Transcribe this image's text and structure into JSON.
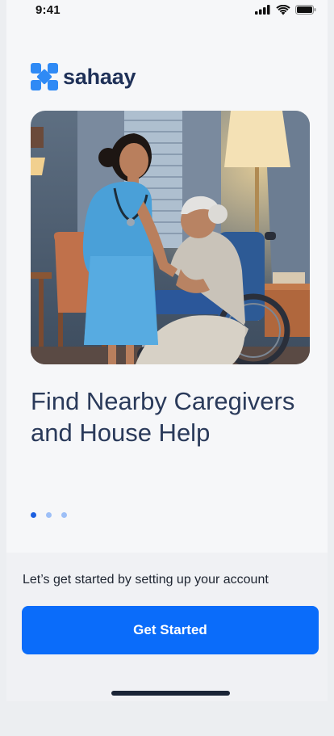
{
  "status_bar": {
    "time": "9:41",
    "icons": [
      "signal-icon",
      "wifi-icon",
      "battery-icon"
    ]
  },
  "brand": {
    "name": "sahaay",
    "logo_icon": "sahaay-logo-icon",
    "logo_color": "#2f8af5"
  },
  "hero": {
    "image_description_icon": "caregiver-illustration"
  },
  "onboarding": {
    "headline": "Find Nearby Caregivers and House Help",
    "page_count": 3,
    "active_page": 1
  },
  "footer": {
    "prompt": "Let’s get started by setting up your account",
    "cta_label": "Get Started",
    "cta_color": "#0a6cfa"
  }
}
